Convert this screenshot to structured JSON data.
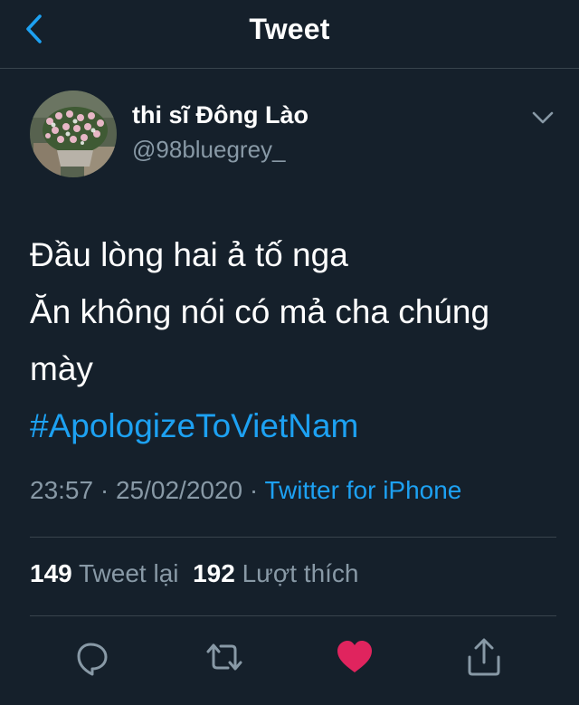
{
  "header": {
    "title": "Tweet",
    "back_icon": "chevron-left-icon"
  },
  "author": {
    "name": "thi sĩ Đông Lào",
    "handle": "@98bluegrey_",
    "avatar": "flowers-avatar"
  },
  "tweet": {
    "lines": [
      "Đầu lòng hai ả tố nga",
      "Ăn không nói có mả cha chúng",
      "mày"
    ],
    "hashtag": "#ApologizeToVietNam"
  },
  "meta": {
    "time": "23:57",
    "separator": " · ",
    "date": "25/02/2020",
    "source": "Twitter for iPhone"
  },
  "stats": {
    "retweets_count": "149",
    "retweets_label": "Tweet lại",
    "likes_count": "192",
    "likes_label": "Lượt thích"
  },
  "actions": [
    "reply-icon",
    "retweet-icon",
    "like-icon",
    "share-icon"
  ],
  "colors": {
    "background": "#15202b",
    "accent": "#1da1f2",
    "secondary_text": "#8899a6",
    "divider": "#38444d",
    "like": "#e0245e"
  }
}
